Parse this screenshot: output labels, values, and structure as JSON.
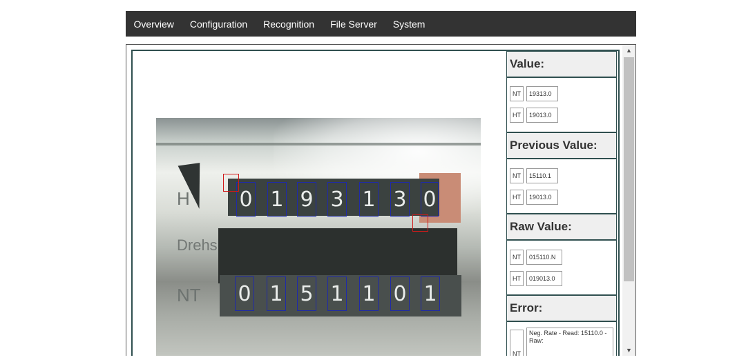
{
  "nav": {
    "items": [
      "Overview",
      "Configuration",
      "Recognition",
      "File Server",
      "System"
    ]
  },
  "digits": {
    "upper": [
      "0",
      "1",
      "9",
      "3",
      "1",
      "3",
      "0"
    ],
    "lower": [
      "0",
      "1",
      "5",
      "1",
      "1",
      "0",
      "1"
    ]
  },
  "photo_text": {
    "h": "H",
    "drehstrom": "Drehs",
    "nt": "NT"
  },
  "panels": {
    "value": {
      "title": "Value:",
      "rows": [
        {
          "tag": "NT",
          "value": "19313.0"
        },
        {
          "tag": "HT",
          "value": "19013.0"
        }
      ]
    },
    "previous": {
      "title": "Previous Value:",
      "rows": [
        {
          "tag": "NT",
          "value": "15110.1"
        },
        {
          "tag": "HT",
          "value": "19013.0"
        }
      ]
    },
    "raw": {
      "title": "Raw Value:",
      "rows": [
        {
          "tag": "NT",
          "value": "015110.N"
        },
        {
          "tag": "HT",
          "value": "019013.0"
        }
      ]
    },
    "error": {
      "title": "Error:",
      "rows": [
        {
          "tag": "NT",
          "value": "Neg. Rate - Read: 15110.0 - Raw:"
        }
      ]
    }
  },
  "scrollbar": {
    "up": "▲",
    "down": "▼"
  },
  "colors": {
    "navbar": "#333333",
    "roi_digit": "#1f2aa8",
    "roi_analog": "#d11a1a",
    "panel_border": "#2f4f4f"
  }
}
